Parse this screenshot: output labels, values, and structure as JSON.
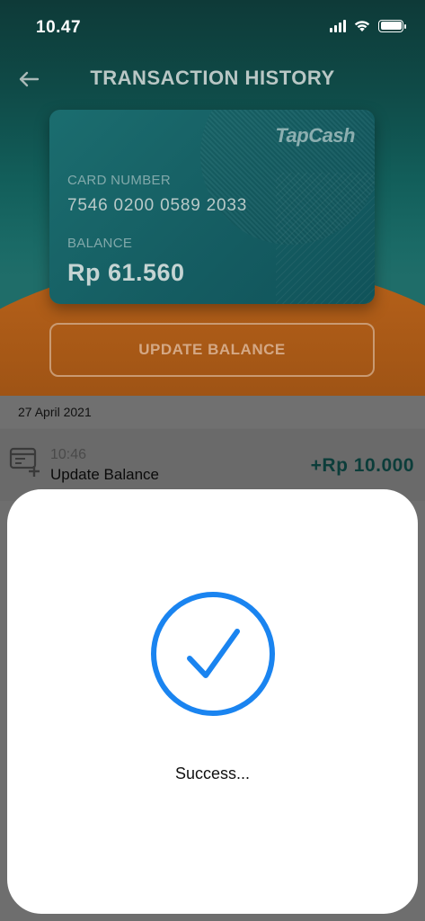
{
  "status_bar": {
    "time": "10.47"
  },
  "header": {
    "title": "TRANSACTION HISTORY"
  },
  "card": {
    "brand": "TapCash",
    "card_number_label": "CARD NUMBER",
    "card_number": "7546 0200 0589 2033",
    "balance_label": "BALANCE",
    "balance": "Rp  61.560"
  },
  "update_button_label": "UPDATE BALANCE",
  "transactions": {
    "date": "27 April 2021",
    "items": [
      {
        "time": "10:46",
        "label": "Update Balance",
        "amount": "+Rp  10.000"
      }
    ]
  },
  "modal": {
    "message": "Success..."
  },
  "colors": {
    "accent_blue": "#1a84f0",
    "card_teal": "#155d62",
    "orange": "#9c5214",
    "amount_teal": "#0c3d3a"
  }
}
